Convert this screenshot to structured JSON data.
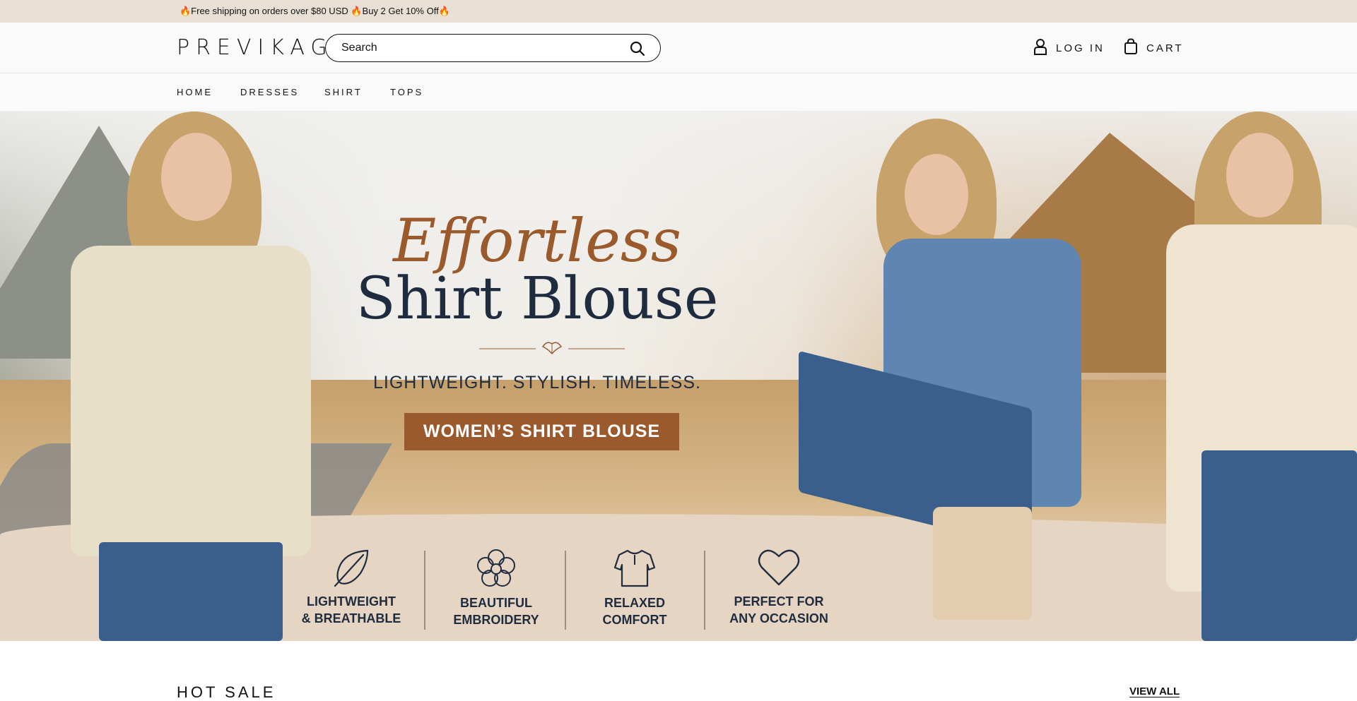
{
  "announcement": {
    "text": "🔥Free shipping on orders over $80 USD 🔥Buy 2 Get 10% Off🔥"
  },
  "header": {
    "logo": "PREVIKAGO",
    "search_placeholder": "Search",
    "search_icon": "search-icon",
    "login_label": "LOG IN",
    "login_icon": "user-icon",
    "cart_label": "CART",
    "cart_icon": "shopping-bag-icon"
  },
  "nav": {
    "items": [
      "HOME",
      "DRESSES",
      "SHIRT",
      "TOPS"
    ]
  },
  "hero": {
    "title_script": "Effortless",
    "title_main": "Shirt Blouse",
    "ornament_icon": "leaf-ornament-icon",
    "tagline": "LIGHTWEIGHT. STYLISH. TIMELESS.",
    "cta_label": "WOMEN’S SHIRT BLOUSE",
    "features": [
      {
        "icon": "leaf-icon",
        "label": "LIGHTWEIGHT\n& BREATHABLE"
      },
      {
        "icon": "flower-icon",
        "label": "BEAUTIFUL\nEMBROIDERY"
      },
      {
        "icon": "shirt-icon",
        "label": "RELAXED\nCOMFORT"
      },
      {
        "icon": "heart-icon",
        "label": "PERFECT FOR\nANY OCCASION"
      }
    ],
    "colors": {
      "accent": "#9b5a2e",
      "navy": "#1f2c40"
    }
  },
  "section": {
    "title": "HOT SALE",
    "view_all": "VIEW ALL"
  }
}
